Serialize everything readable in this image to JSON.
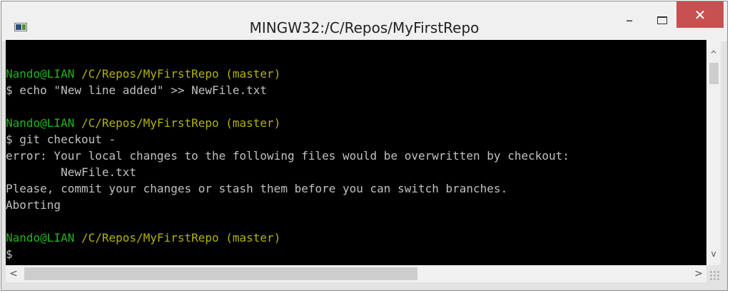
{
  "window": {
    "title": "MINGW32:/C/Repos/MyFirstRepo",
    "controls": {
      "minimize": "–",
      "close": "✕"
    }
  },
  "terminal": {
    "lines": [
      {
        "type": "prompt",
        "user": "Nando@LIAN",
        "path": "/C/Repos/MyFirstRepo (master)"
      },
      {
        "type": "text",
        "text": "$ echo \"New line added\" >> NewFile.txt"
      },
      {
        "type": "blank",
        "text": ""
      },
      {
        "type": "prompt",
        "user": "Nando@LIAN",
        "path": "/C/Repos/MyFirstRepo (master)"
      },
      {
        "type": "text",
        "text": "$ git checkout -"
      },
      {
        "type": "text",
        "text": "error: Your local changes to the following files would be overwritten by checkout:"
      },
      {
        "type": "text",
        "text": "        NewFile.txt"
      },
      {
        "type": "text",
        "text": "Please, commit your changes or stash them before you can switch branches."
      },
      {
        "type": "text",
        "text": "Aborting"
      },
      {
        "type": "blank",
        "text": ""
      },
      {
        "type": "prompt",
        "user": "Nando@LIAN",
        "path": "/C/Repos/MyFirstRepo (master)"
      },
      {
        "type": "text",
        "text": "$"
      }
    ]
  },
  "scrollbars": {
    "up": "^",
    "down": "v",
    "left": "<",
    "right": ">"
  },
  "colors": {
    "user": "#1fb51f",
    "path": "#b3b300",
    "text": "#c0c0c0",
    "background": "#000000",
    "close_button": "#c75050"
  },
  "icons": [
    "app-icon",
    "minimize-icon",
    "maximize-icon",
    "close-icon",
    "scroll-up-icon",
    "scroll-down-icon",
    "scroll-left-icon",
    "scroll-right-icon",
    "resize-grip-icon"
  ]
}
